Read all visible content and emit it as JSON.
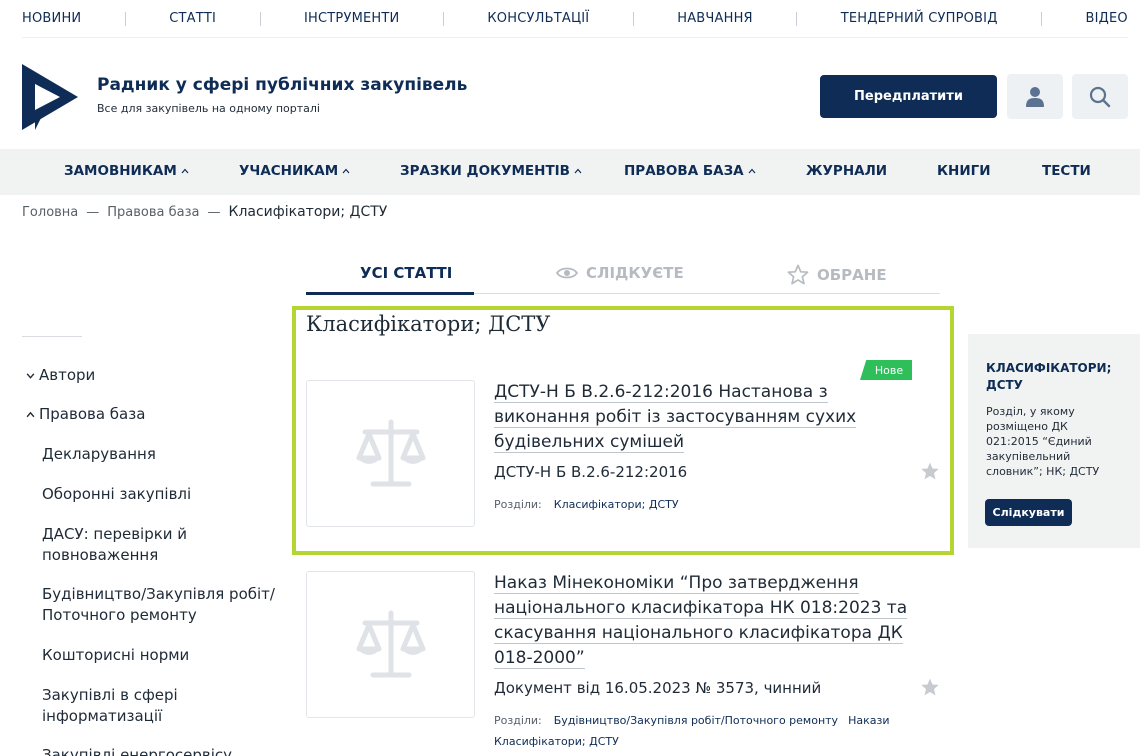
{
  "topnav": [
    "НОВИНИ",
    "СТАТТІ",
    "ІНСТРУМЕНТИ",
    "КОНСУЛЬТАЦІЇ",
    "НАВЧАННЯ",
    "ТЕНДЕРНИЙ СУПРОВІД",
    "ВІДЕО"
  ],
  "brand": {
    "title": "Радник у сфері публічних закупівель",
    "subtitle": "Все для закупівель на одному порталі"
  },
  "header": {
    "subscribe_label": "Передплатити",
    "user_icon": "user-icon",
    "search_icon": "search-icon"
  },
  "mainnav": [
    "ЗАМОВНИКАМ",
    "УЧАСНИКАМ",
    "ЗРАЗКИ ДОКУМЕНТІВ",
    "ПРАВОВА БАЗА",
    "ЖУРНАЛИ",
    "КНИГИ",
    "ТЕСТИ"
  ],
  "breadcrumb": {
    "home": "Головна",
    "sep": "—",
    "section": "Правова база",
    "current": "Класифікатори; ДСТУ"
  },
  "tabs": {
    "all": "УСІ СТАТТІ",
    "following": "СЛІДКУЄТЕ",
    "favorites": "ОБРАНЕ"
  },
  "sidebar": {
    "authors": "Автори",
    "legal_base": "Правова база",
    "items": [
      "Декларування",
      "Оборонні закупівлі",
      "ДАСУ: перевірки й повноваження",
      "Будівництво/Закупівля робіт/ Поточного ремонту",
      "Кошторисні норми",
      "Закупівлі в сфері інформатизації",
      "Закупівлі енергосервісу"
    ]
  },
  "section_title": "Класифікатори; ДСТУ",
  "articles": [
    {
      "badge": "Нове",
      "title": "ДСТУ-Н Б В.2.6-212:2016 Настанова з виконання робіт із застосуванням сухих будівельних сумішей",
      "meta": "ДСТУ-Н Б В.2.6-212:2016",
      "sections_label": "Розділи:",
      "sections": [
        "Класифікатори; ДСТУ"
      ]
    },
    {
      "title": "Наказ Мінекономіки “Про затвердження національного класифікатора НК 018:2023 та скасування національного класифікатора ДК 018-2000”",
      "meta": "Документ від 16.05.2023 № 3573, чинний",
      "sections_label": "Розділи:",
      "sections": [
        "Будівництво/Закупівля робіт/Поточного ремонту",
        "Накази",
        "Класифікатори; ДСТУ"
      ]
    }
  ],
  "right_panel": {
    "title": "КЛАСИФІКАТОРИ; ДСТУ",
    "description": "Розділ, у якому розміщено ДК 021:2015 “Єдиний закупівельний словник”; НК; ДСТУ",
    "follow_label": "Слідкувати"
  },
  "colors": {
    "brand": "#0e2c55",
    "highlight": "#b5d632",
    "badge": "#2fbf5a"
  }
}
